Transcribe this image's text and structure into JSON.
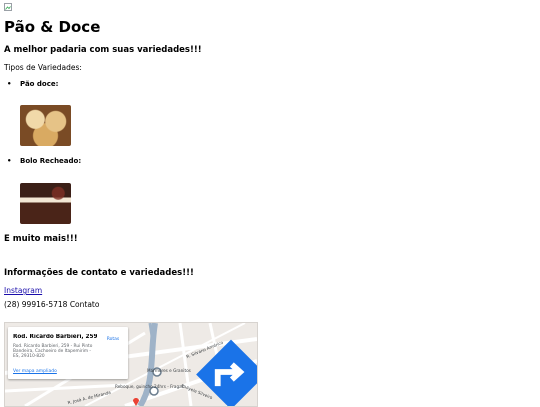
{
  "header": {
    "logo_alt": "",
    "title": "Pão & Doce",
    "tagline": "A melhor padaria com suas variedades!!!"
  },
  "varieties": {
    "label": "Tipos de Variedades:",
    "items": [
      {
        "name": "Pão doce:"
      },
      {
        "name": "Bolo Recheado:"
      }
    ],
    "more": "E muito mais!!!"
  },
  "contact": {
    "title": "Informações de contato e variedades!!!",
    "instagram_link": "Instagram",
    "phone": "(28) 99916-5718 Contato"
  },
  "map": {
    "place_title": "Rod. Ricardo Barbieri, 259 - R...",
    "address": "Rod. Ricardo Barbieri, 259 - Rui Pinto Bandeira, Cachoeiro de Itapemirim - ES, 29310-820",
    "route_label": "Rotas",
    "view_larger": "Ver mapa ampliado",
    "street_labels": [
      "R. Ayele Silveiro",
      "R. Silvano Américo",
      "Mármores e Granitos",
      "Reboque, guincho 24hrs - Fragata",
      "R. Josá A. de Miranda",
      "W.R. Silveira"
    ],
    "road_color": "#ffffff",
    "highway_color": "#9fb3c8",
    "pin_color": "#ea4335"
  }
}
